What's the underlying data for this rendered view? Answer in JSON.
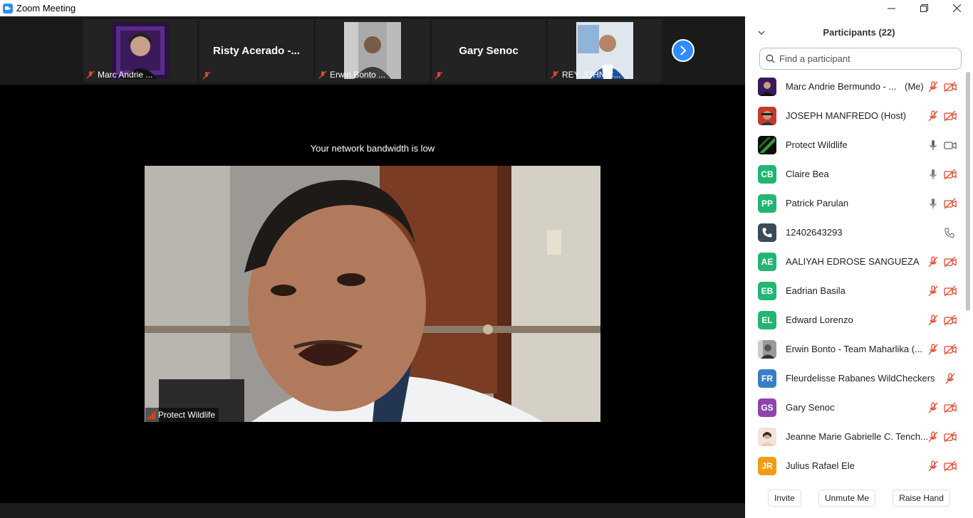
{
  "window": {
    "title": "Zoom Meeting",
    "controls": [
      "minimize",
      "maximize",
      "close"
    ]
  },
  "thumbnails": [
    {
      "label": "Marc Andrie ...",
      "display": "photo",
      "muted": true
    },
    {
      "big_name": "Risty Acerado -...",
      "label": "",
      "display": "name",
      "muted": true
    },
    {
      "label": "Erwin Bonto ...",
      "display": "photo",
      "muted": true
    },
    {
      "big_name": "Gary Senoc",
      "label": "",
      "display": "name",
      "muted": true
    },
    {
      "label": "REY JOHN C...",
      "display": "photo",
      "muted": true
    }
  ],
  "main_video": {
    "notice": "Your network bandwidth is low",
    "speaker_label": "Protect Wildlife"
  },
  "panel": {
    "title": "Participants (22)",
    "search_placeholder": "Find a participant",
    "participants": [
      {
        "name": "Marc Andrie Bermundo - ...",
        "tag": "(Me)",
        "initials": "",
        "avatar_color": "#4a2b6b",
        "mic": "muted",
        "cam": "off"
      },
      {
        "name": "JOSEPH MANFREDO (Host)",
        "tag": "",
        "initials": "",
        "avatar_color": "#6b4a3a",
        "mic": "muted",
        "cam": "off"
      },
      {
        "name": "Protect Wildlife",
        "tag": "",
        "initials": "",
        "avatar_color": "#1b3a1b",
        "mic": "on",
        "cam": "on"
      },
      {
        "name": "Claire Bea",
        "tag": "",
        "initials": "CB",
        "avatar_color": "#23b574",
        "mic": "on",
        "cam": "off"
      },
      {
        "name": "Patrick Parulan",
        "tag": "",
        "initials": "PP",
        "avatar_color": "#23b574",
        "mic": "on",
        "cam": "off"
      },
      {
        "name": "12402643293",
        "tag": "",
        "initials": "",
        "avatar_color": "#394b59",
        "mic": "phone",
        "cam": "none"
      },
      {
        "name": "AALIYAH EDROSE SANGUEZA",
        "tag": "",
        "initials": "AE",
        "avatar_color": "#23b574",
        "mic": "muted",
        "cam": "off"
      },
      {
        "name": "Eadrian Basila",
        "tag": "",
        "initials": "EB",
        "avatar_color": "#23b574",
        "mic": "muted",
        "cam": "off"
      },
      {
        "name": "Edward Lorenzo",
        "tag": "",
        "initials": "EL",
        "avatar_color": "#23b574",
        "mic": "muted",
        "cam": "off"
      },
      {
        "name": "Erwin Bonto - Team Maharlika (...",
        "tag": "",
        "initials": "",
        "avatar_color": "#777777",
        "mic": "muted",
        "cam": "off"
      },
      {
        "name": "Fleurdelisse Rabanes WildCheckers ...",
        "tag": "",
        "initials": "FR",
        "avatar_color": "#3a7fc4",
        "mic": "none",
        "cam": "muted"
      },
      {
        "name": "Gary Senoc",
        "tag": "",
        "initials": "GS",
        "avatar_color": "#8e44ad",
        "mic": "muted",
        "cam": "off"
      },
      {
        "name": "Jeanne Marie Gabrielle C. Tench...",
        "tag": "",
        "initials": "",
        "avatar_color": "#e8c9b8",
        "mic": "muted",
        "cam": "off"
      },
      {
        "name": "Julius Rafael Ele",
        "tag": "",
        "initials": "JR",
        "avatar_color": "#f39c12",
        "mic": "muted",
        "cam": "off"
      }
    ],
    "footer": {
      "invite": "Invite",
      "unmute": "Unmute Me",
      "raise_hand": "Raise Hand"
    }
  },
  "colors": {
    "accent": "#2d8cff",
    "muted_red": "#e0462d"
  }
}
